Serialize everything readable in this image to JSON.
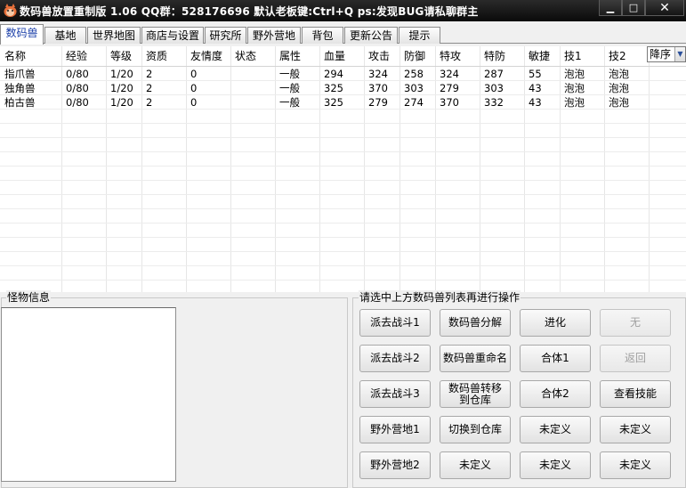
{
  "window": {
    "title": "数码兽放置重制版 1.06    QQ群：528176696    默认老板键:Ctrl+Q    ps:发现BUG请私聊群主",
    "minimize": "▁",
    "maximize": "□",
    "close": "✕"
  },
  "tabs": [
    "数码兽",
    "基地",
    "世界地图",
    "商店与设置",
    "研究所",
    "野外营地",
    "背包",
    "更新公告",
    "提示"
  ],
  "grid": {
    "columns": [
      "名称",
      "经验",
      "等级",
      "资质",
      "友情度",
      "状态",
      "属性",
      "血量",
      "攻击",
      "防御",
      "特攻",
      "特防",
      "敏捷",
      "技1",
      "技2"
    ],
    "rows": [
      [
        "指爪兽",
        "0/80",
        "1/20",
        "2",
        "0",
        "",
        "一般",
        "294",
        "324",
        "258",
        "324",
        "287",
        "55",
        "泡泡",
        "泡泡"
      ],
      [
        "独角兽",
        "0/80",
        "1/20",
        "2",
        "0",
        "",
        "一般",
        "325",
        "370",
        "303",
        "279",
        "303",
        "43",
        "泡泡",
        "泡泡"
      ],
      [
        "柏古兽",
        "0/80",
        "1/20",
        "2",
        "0",
        "",
        "一般",
        "325",
        "279",
        "274",
        "370",
        "332",
        "43",
        "泡泡",
        "泡泡"
      ]
    ],
    "sort_label": "降序"
  },
  "monster_info": {
    "title": "怪物信息"
  },
  "actions": {
    "title": "请选中上方数码兽列表再进行操作",
    "buttons": [
      [
        "派去战斗1",
        "数码兽分解",
        "进化",
        "无"
      ],
      [
        "派去战斗2",
        "数码兽重命名",
        "合体1",
        "返回"
      ],
      [
        "派去战斗3",
        "数码兽转移到仓库",
        "合体2",
        "查看技能"
      ],
      [
        "野外营地1",
        "切换到仓库",
        "未定义",
        "未定义"
      ],
      [
        "野外营地2",
        "未定义",
        "未定义",
        "未定义"
      ]
    ]
  }
}
